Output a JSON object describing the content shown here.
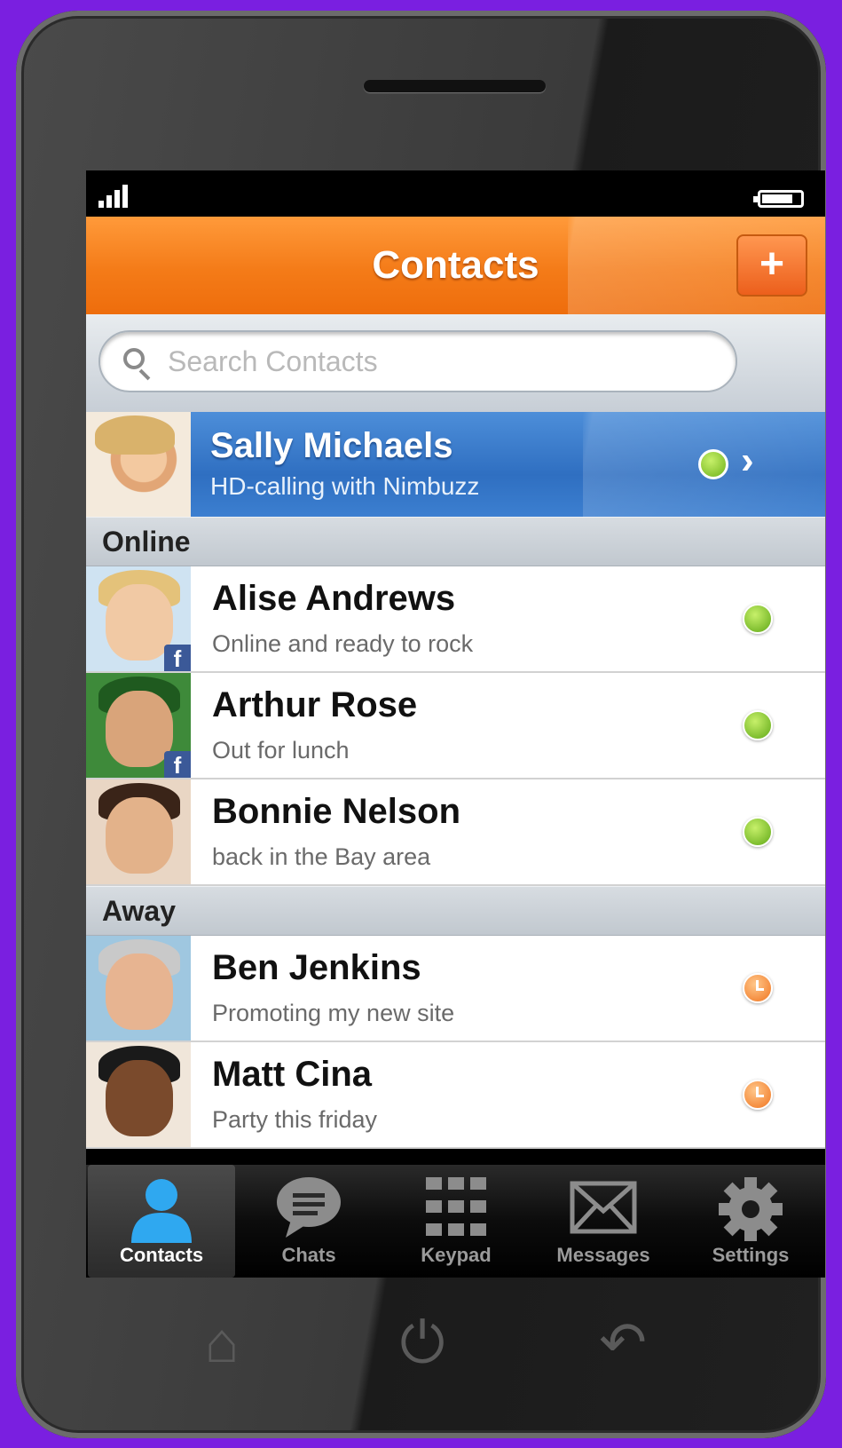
{
  "navbar": {
    "title": "Contacts",
    "add_label": "+"
  },
  "search": {
    "placeholder": "Search Contacts"
  },
  "featured": {
    "name": "Sally Michaels",
    "status": "HD-calling with Nimbuzz",
    "chevron": "›"
  },
  "sections": [
    {
      "title": "Online"
    },
    {
      "title": "Away"
    }
  ],
  "contacts": [
    {
      "name": "Alise Andrews",
      "status": "Online and ready to rock",
      "presence": "online",
      "network_badge": "f"
    },
    {
      "name": "Arthur Rose",
      "status": "Out for lunch",
      "presence": "online",
      "network_badge": "f"
    },
    {
      "name": "Bonnie Nelson",
      "status": "back in the Bay area",
      "presence": "online"
    },
    {
      "name": "Ben Jenkins",
      "status": "Promoting my new site",
      "presence": "away"
    },
    {
      "name": "Matt Cina",
      "status": "Party this friday",
      "presence": "away"
    }
  ],
  "tabs": [
    {
      "label": "Contacts",
      "icon": "person-icon",
      "selected": true
    },
    {
      "label": "Chats",
      "icon": "chat-bubble-icon"
    },
    {
      "label": "Keypad",
      "icon": "keypad-icon"
    },
    {
      "label": "Messages",
      "icon": "envelope-icon"
    },
    {
      "label": "Settings",
      "icon": "gear-icon"
    }
  ],
  "hardware_buttons": [
    {
      "icon": "home-icon",
      "glyph": "⌂"
    },
    {
      "icon": "power-icon",
      "glyph": "⏻"
    },
    {
      "icon": "back-icon",
      "glyph": "↶"
    }
  ],
  "colors": {
    "background": "#7a1fe0",
    "navbar_orange": "#f47b18",
    "featured_blue": "#2f6fc1",
    "online_green": "#6fb21b",
    "away_orange": "#f0741f",
    "tab_selected_icon": "#2fa8f0"
  }
}
